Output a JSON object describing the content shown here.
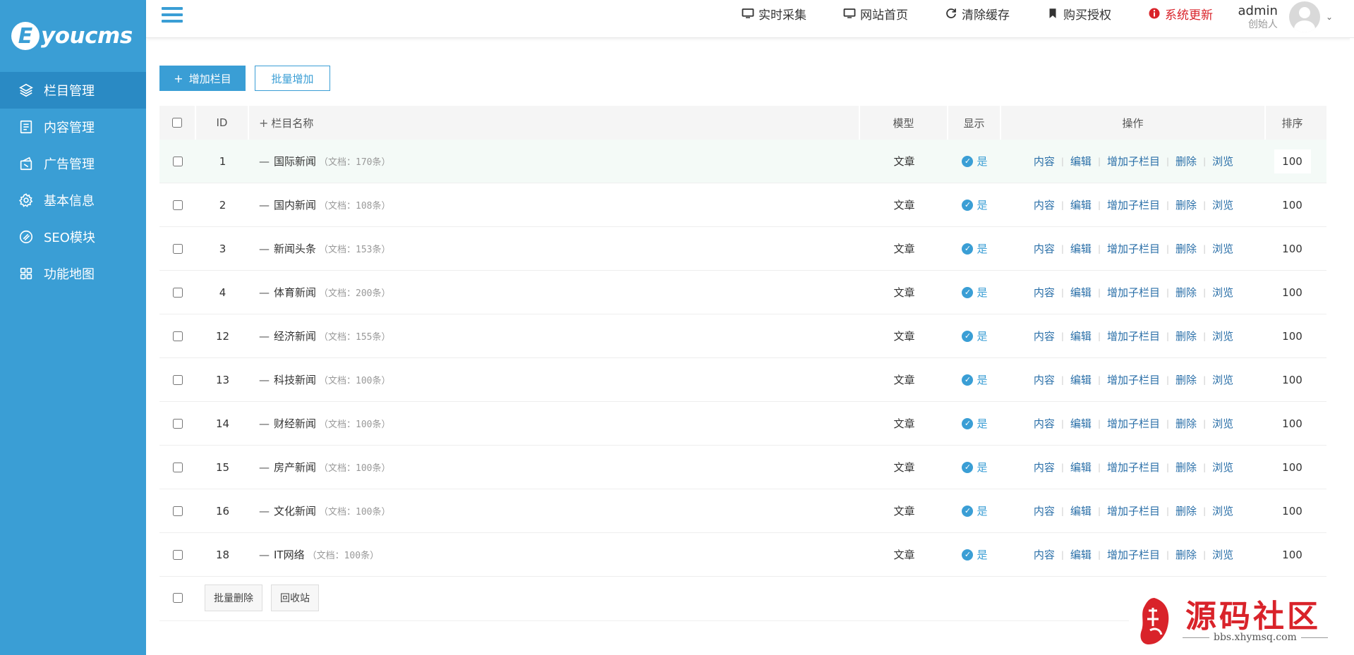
{
  "brand": {
    "letter": "E",
    "name": "youcms"
  },
  "sidebar": {
    "items": [
      {
        "label": "栏目管理",
        "icon": "layers-icon",
        "active": true
      },
      {
        "label": "内容管理",
        "icon": "document-icon",
        "active": false
      },
      {
        "label": "广告管理",
        "icon": "ad-icon",
        "active": false
      },
      {
        "label": "基本信息",
        "icon": "gear-icon",
        "active": false
      },
      {
        "label": "SEO模块",
        "icon": "seo-icon",
        "active": false
      },
      {
        "label": "功能地图",
        "icon": "grid-icon",
        "active": false
      }
    ]
  },
  "header": {
    "links": [
      {
        "label": "实时采集",
        "icon": "monitor-icon"
      },
      {
        "label": "网站首页",
        "icon": "monitor-icon"
      },
      {
        "label": "清除缓存",
        "icon": "refresh-icon"
      },
      {
        "label": "购买授权",
        "icon": "bookmark-icon"
      },
      {
        "label": "系统更新",
        "icon": "info-icon"
      }
    ],
    "user": {
      "name": "admin",
      "role": "创始人"
    }
  },
  "toolbar": {
    "add_label": "增加栏目",
    "batch_add_label": "批量增加"
  },
  "table": {
    "headers": {
      "id": "ID",
      "name": "栏目名称",
      "model": "模型",
      "show": "显示",
      "ops": "操作",
      "sort": "排序"
    },
    "ops_labels": [
      "内容",
      "编辑",
      "增加子栏目",
      "删除",
      "浏览"
    ],
    "rows": [
      {
        "id": "1",
        "name": "国际新闻",
        "doc": "（文档：170条）",
        "model": "文章",
        "show": "是",
        "sort": "100"
      },
      {
        "id": "2",
        "name": "国内新闻",
        "doc": "（文档：108条）",
        "model": "文章",
        "show": "是",
        "sort": "100"
      },
      {
        "id": "3",
        "name": "新闻头条",
        "doc": "（文档：153条）",
        "model": "文章",
        "show": "是",
        "sort": "100"
      },
      {
        "id": "4",
        "name": "体育新闻",
        "doc": "（文档：200条）",
        "model": "文章",
        "show": "是",
        "sort": "100"
      },
      {
        "id": "12",
        "name": "经济新闻",
        "doc": "（文档：155条）",
        "model": "文章",
        "show": "是",
        "sort": "100"
      },
      {
        "id": "13",
        "name": "科技新闻",
        "doc": "（文档：100条）",
        "model": "文章",
        "show": "是",
        "sort": "100"
      },
      {
        "id": "14",
        "name": "财经新闻",
        "doc": "（文档：100条）",
        "model": "文章",
        "show": "是",
        "sort": "100"
      },
      {
        "id": "15",
        "name": "房产新闻",
        "doc": "（文档：100条）",
        "model": "文章",
        "show": "是",
        "sort": "100"
      },
      {
        "id": "16",
        "name": "文化新闻",
        "doc": "（文档：100条）",
        "model": "文章",
        "show": "是",
        "sort": "100"
      },
      {
        "id": "18",
        "name": "IT网络",
        "doc": "（文档：100条）",
        "model": "文章",
        "show": "是",
        "sort": "100"
      }
    ]
  },
  "footer": {
    "batch_delete_label": "批量删除",
    "recycle_label": "回收站"
  },
  "watermark": {
    "title": "源码社区",
    "url": "bbs.xhymsq.com"
  },
  "colors": {
    "brand_blue": "#3a9ed5",
    "active_blue": "#2a8ac4",
    "alert_red": "#d9232a",
    "link_blue": "#2a6fa8"
  }
}
